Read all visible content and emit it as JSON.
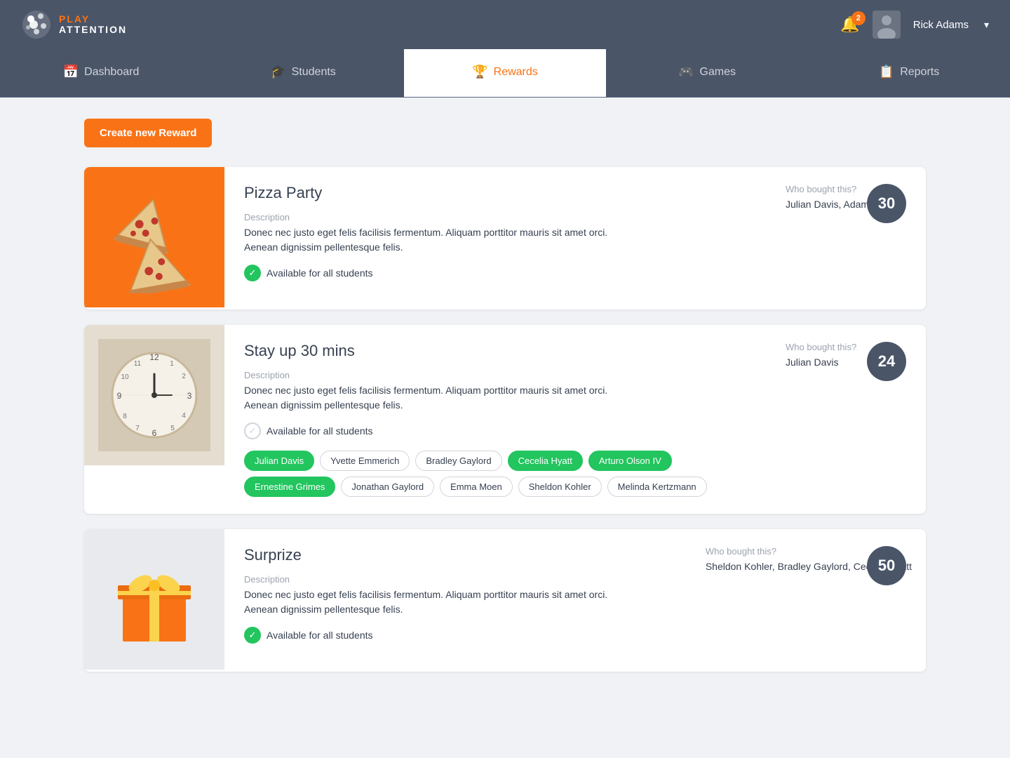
{
  "header": {
    "logo_play": "PLAY",
    "logo_attention": "ATTENTION",
    "notification_count": "2",
    "user_name": "Rick Adams"
  },
  "nav": {
    "items": [
      {
        "id": "dashboard",
        "label": "Dashboard",
        "icon": "📅",
        "active": false
      },
      {
        "id": "students",
        "label": "Students",
        "icon": "🎓",
        "active": false
      },
      {
        "id": "rewards",
        "label": "Rewards",
        "icon": "🏆",
        "active": true
      },
      {
        "id": "games",
        "label": "Games",
        "icon": "🎮",
        "active": false
      },
      {
        "id": "reports",
        "label": "Reports",
        "icon": "📋",
        "active": false
      }
    ]
  },
  "create_button": "Create new Reward",
  "rewards": [
    {
      "id": "pizza-party",
      "title": "Pizza Party",
      "description_label": "Description",
      "description": "Donec nec justo eget felis facilisis fermentum. Aliquam porttitor mauris sit amet orci. Aenean dignissim pellentesque felis.",
      "available": true,
      "available_text": "Available for all students",
      "count": "30",
      "who_label": "Who bought this?",
      "who": "Julian Davis, Adam Hughes",
      "tags": [],
      "image_type": "pizza"
    },
    {
      "id": "stay-up",
      "title": "Stay up 30 mins",
      "description_label": "Description",
      "description": "Donec nec justo eget felis facilisis fermentum. Aliquam porttitor mauris sit amet orci. Aenean dignissim pellentesque felis.",
      "available": false,
      "available_text": "Available for all students",
      "count": "24",
      "who_label": "Who bought this?",
      "who": "Julian Davis",
      "tags": [
        {
          "label": "Julian Davis",
          "active": true
        },
        {
          "label": "Yvette Emmerich",
          "active": false
        },
        {
          "label": "Bradley Gaylord",
          "active": false
        },
        {
          "label": "Cecelia Hyatt",
          "active": true
        },
        {
          "label": "Arturo Olson IV",
          "active": true
        },
        {
          "label": "Ernestine Grimes",
          "active": true
        },
        {
          "label": "Jonathan Gaylord",
          "active": false
        },
        {
          "label": "Emma Moen",
          "active": false
        },
        {
          "label": "Sheldon Kohler",
          "active": false
        },
        {
          "label": "Melinda Kertzmann",
          "active": false
        }
      ],
      "image_type": "clock"
    },
    {
      "id": "surprize",
      "title": "Surprize",
      "description_label": "Description",
      "description": "Donec nec justo eget felis facilisis fermentum. Aliquam porttitor mauris sit amet orci. Aenean dignissim pellentesque felis.",
      "available": true,
      "available_text": "Available for all students",
      "count": "50",
      "who_label": "Who bought this?",
      "who": "Sheldon Kohler, Bradley Gaylord, Cecelia Hyatt",
      "tags": [],
      "image_type": "surprise"
    }
  ]
}
